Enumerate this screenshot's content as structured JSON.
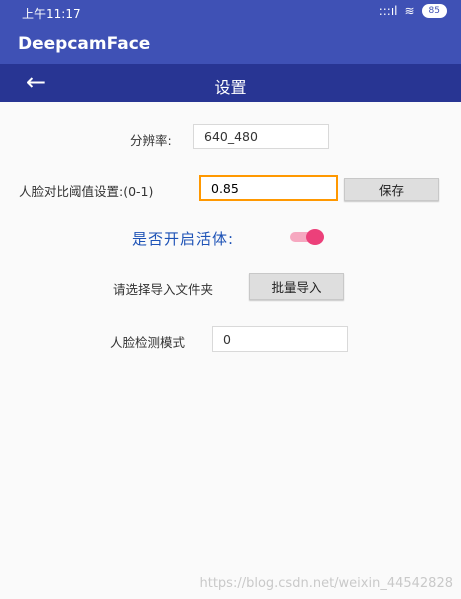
{
  "status": {
    "time": "上午11:17",
    "signal": ":::ıl",
    "wifi": "≋",
    "battery": "85"
  },
  "app": {
    "title": "DeepcamFace"
  },
  "nav": {
    "back": "←",
    "title": "设置"
  },
  "settings": {
    "resolution_label": "分辨率:",
    "resolution_value": "640_480",
    "threshold_label": "人脸对比阈值设置:(0-1)",
    "threshold_value": "0.85",
    "save_button": "保存",
    "liveness_label": "是否开启活体:",
    "liveness_enabled": true,
    "import_label": "请选择导入文件夹",
    "import_button": "批量导入",
    "detect_mode_label": "人脸检测模式",
    "detect_mode_value": "0"
  },
  "watermark": "https://blog.csdn.net/weixin_44542828"
}
